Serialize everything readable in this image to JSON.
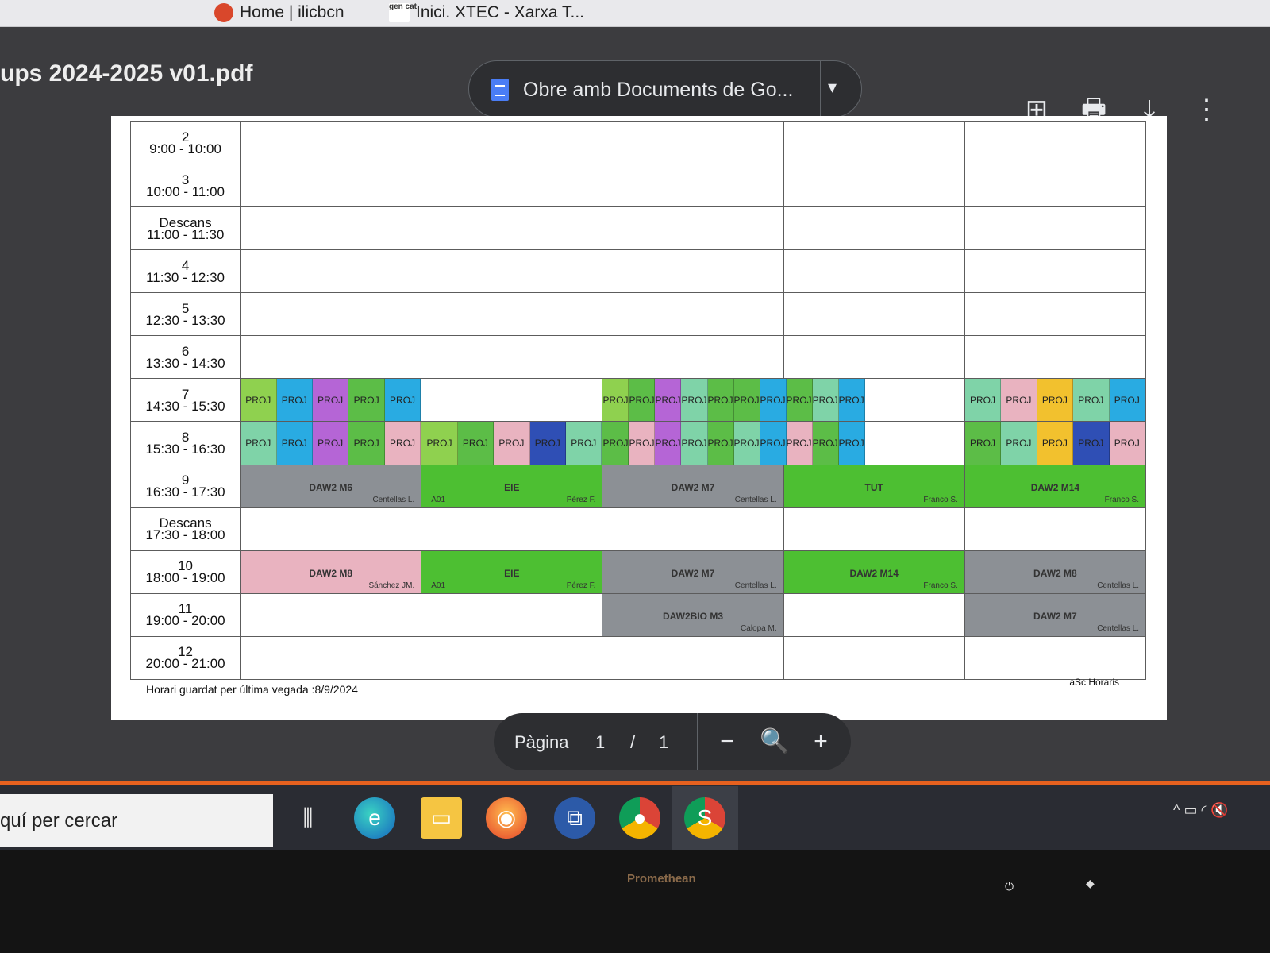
{
  "browser": {
    "tabs": [
      {
        "label": "Home | ilicbcn",
        "favicon": "home-favicon"
      },
      {
        "label": "Inici. XTEC - Xarxa T...",
        "favicon": "gencat-favicon",
        "favicon_text": "gen cat"
      }
    ]
  },
  "viewer": {
    "doc_title": "ups 2024-2025 v01.pdf",
    "open_with_label": "Obre amb Documents de Go...",
    "page_label": "Pàgina",
    "page_current": "1",
    "page_sep": "/",
    "page_total": "1",
    "icons": {
      "add_note": "⊞",
      "print": "🖶",
      "download": "⤓",
      "more": "⋮",
      "zoom_out": "−",
      "zoom": "🔍",
      "zoom_in": "+",
      "caret": "▾"
    }
  },
  "timetable": {
    "rows": [
      {
        "num": "2",
        "time": "9:00 - 10:00"
      },
      {
        "num": "3",
        "time": "10:00 - 11:00"
      },
      {
        "num": "Descans",
        "time": "11:00 - 11:30"
      },
      {
        "num": "4",
        "time": "11:30 - 12:30"
      },
      {
        "num": "5",
        "time": "12:30 - 13:30"
      },
      {
        "num": "6",
        "time": "13:30 - 14:30"
      },
      {
        "num": "7",
        "time": "14:30 - 15:30"
      },
      {
        "num": "8",
        "time": "15:30 - 16:30"
      },
      {
        "num": "9",
        "time": "16:30 - 17:30"
      },
      {
        "num": "Descans",
        "time": "17:30 - 18:00"
      },
      {
        "num": "10",
        "time": "18:00 - 19:00"
      },
      {
        "num": "11",
        "time": "19:00 - 20:00"
      },
      {
        "num": "12",
        "time": "20:00 - 21:00"
      }
    ],
    "proj_label": "PROJ",
    "lessons": {
      "mon_9": {
        "code": "DAW2 M6",
        "room": "",
        "teacher": "Centellas L."
      },
      "tue_9": {
        "code": "EIE",
        "room": "A01",
        "teacher": "Pérez F."
      },
      "wed_9": {
        "code": "DAW2 M7",
        "room": "",
        "teacher": "Centellas L."
      },
      "thu_9": {
        "code": "TUT",
        "room": "",
        "teacher": "Franco S."
      },
      "fri_9": {
        "code": "DAW2 M14",
        "room": "",
        "teacher": "Franco S."
      },
      "mon_10": {
        "code": "DAW2 M8",
        "room": "",
        "teacher": "Sánchez JM."
      },
      "tue_10": {
        "code": "EIE",
        "room": "A01",
        "teacher": "Pérez F."
      },
      "wed_10": {
        "code": "DAW2 M7",
        "room": "",
        "teacher": "Centellas L."
      },
      "thu_10": {
        "code": "DAW2 M14",
        "room": "",
        "teacher": "Franco S."
      },
      "fri_10": {
        "code": "DAW2 M8",
        "room": "",
        "teacher": "Centellas L."
      },
      "wed_11": {
        "code": "DAW2BIO M3",
        "room": "",
        "teacher": "Calopa M."
      },
      "fri_11": {
        "code": "DAW2 M7",
        "room": "",
        "teacher": "Centellas L."
      }
    },
    "save_note": "Horari guardat per última vegada :8/9/2024",
    "credit": "aSc Horaris"
  },
  "colors": {
    "gray_lesson": "#8c9095",
    "green_lesson": "#4dbf32",
    "pink_lesson": "#e9b3c0",
    "proj_palette": [
      "#8fd14f",
      "#29abe2",
      "#b565d6",
      "#5cbd47",
      "#e9b3c0",
      "#7fd3a8",
      "#f2c12e",
      "#2f4fb5"
    ]
  },
  "taskbar": {
    "search_text": "quí per cercar",
    "icons": {
      "task_view": "⫼",
      "edge": "e",
      "explorer": "▭",
      "firefox": "◉",
      "window": "⧉",
      "chrome": "●",
      "chrome_profile": "S"
    },
    "tray": "^ ▭ ◜ 🔇"
  },
  "monitor": {
    "brand": "Promethean",
    "power_icon": "⏻",
    "touch_icon": "◆"
  }
}
